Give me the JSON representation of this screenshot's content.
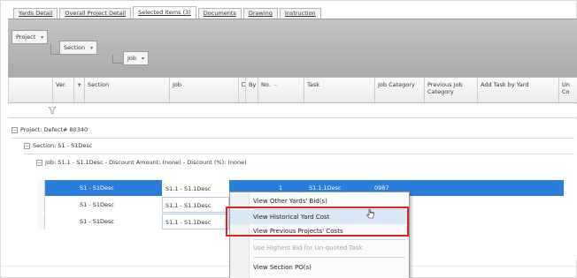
{
  "tabs": [
    {
      "label": "Yards Detail"
    },
    {
      "label": "Overall Project Detail"
    },
    {
      "label": "Selected Items (3)"
    },
    {
      "label": "Documents"
    },
    {
      "label": "Drawing"
    },
    {
      "label": "Instruction"
    }
  ],
  "group_panel": {
    "chips": [
      {
        "label": "Project"
      },
      {
        "label": "Section"
      },
      {
        "label": "Job"
      }
    ]
  },
  "columns": {
    "ver": "Ver.",
    "plus": "+",
    "section": "Section",
    "job": "Job",
    "by": "By",
    "no": "No.",
    "task": "Task",
    "job_category": "Job Category",
    "previous_job_category": "Previous Job Category",
    "add_task_by_yard": "Add Task by Yard",
    "un": "Un Co"
  },
  "groups": {
    "project": "Project: Defect# 80340",
    "section": "Section: S1 - S1Desc",
    "job": "Job: S1.1 - S1.1Desc - Discount Amount: (none) - Discount (%): (none)"
  },
  "rows": [
    {
      "section": "S1 - S1Desc",
      "job": "S1.1 - S1.1Desc",
      "no": "1",
      "task": "S1.1.1Desc",
      "job_category": "0987"
    },
    {
      "section": "S1 - S1Desc",
      "job": "S1.1 - S1.1Desc"
    },
    {
      "section": "S1 - S1Desc",
      "job": "S1.1 - S1.1Desc"
    }
  ],
  "context_menu": {
    "items": [
      {
        "label": "View Other Yards' Bid(s)",
        "state": "enabled"
      },
      {
        "label": "View Historical Yard Cost",
        "state": "hover"
      },
      {
        "label": "View Previous Projects' Costs",
        "state": "enabled"
      },
      {
        "label": "Use Highest Bid for Un-quoted Task",
        "state": "disabled"
      },
      {
        "label": "View Section PO(s)",
        "state": "enabled"
      }
    ]
  },
  "colors": {
    "selection": "#2a7ddb",
    "highlight_border": "#d8232a",
    "group_panel": "#b5b5b5"
  }
}
